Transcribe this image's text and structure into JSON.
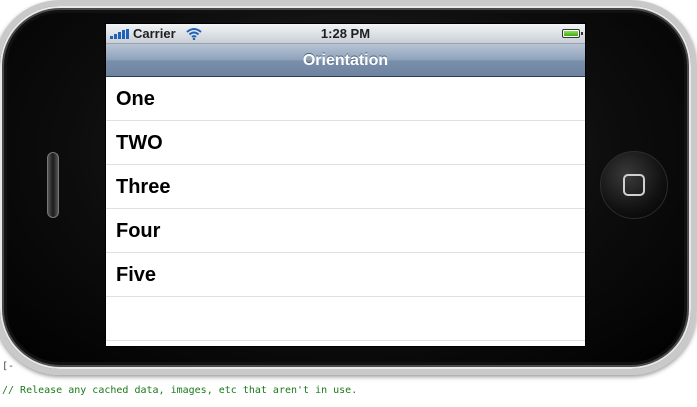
{
  "status_bar": {
    "carrier": "Carrier",
    "time": "1:28 PM"
  },
  "nav_bar": {
    "title": "Orientation"
  },
  "table": {
    "rows": [
      {
        "label": "One"
      },
      {
        "label": "TWO"
      },
      {
        "label": "Three"
      },
      {
        "label": "Four"
      },
      {
        "label": "Five"
      },
      {
        "label": ""
      }
    ]
  },
  "editor": {
    "code_comment": "// Release any cached data, images, etc that aren't in use.",
    "left_marker": "[-"
  },
  "icons": {
    "signal": "signal-strength-icon",
    "wifi": "wifi-icon",
    "battery": "battery-icon",
    "home": "home-button-icon"
  },
  "colors": {
    "nav_bar": "#7a8fab",
    "signal": "#1f62b7",
    "battery_fill": "#3daa18",
    "code_comment": "#1a7a1a"
  }
}
